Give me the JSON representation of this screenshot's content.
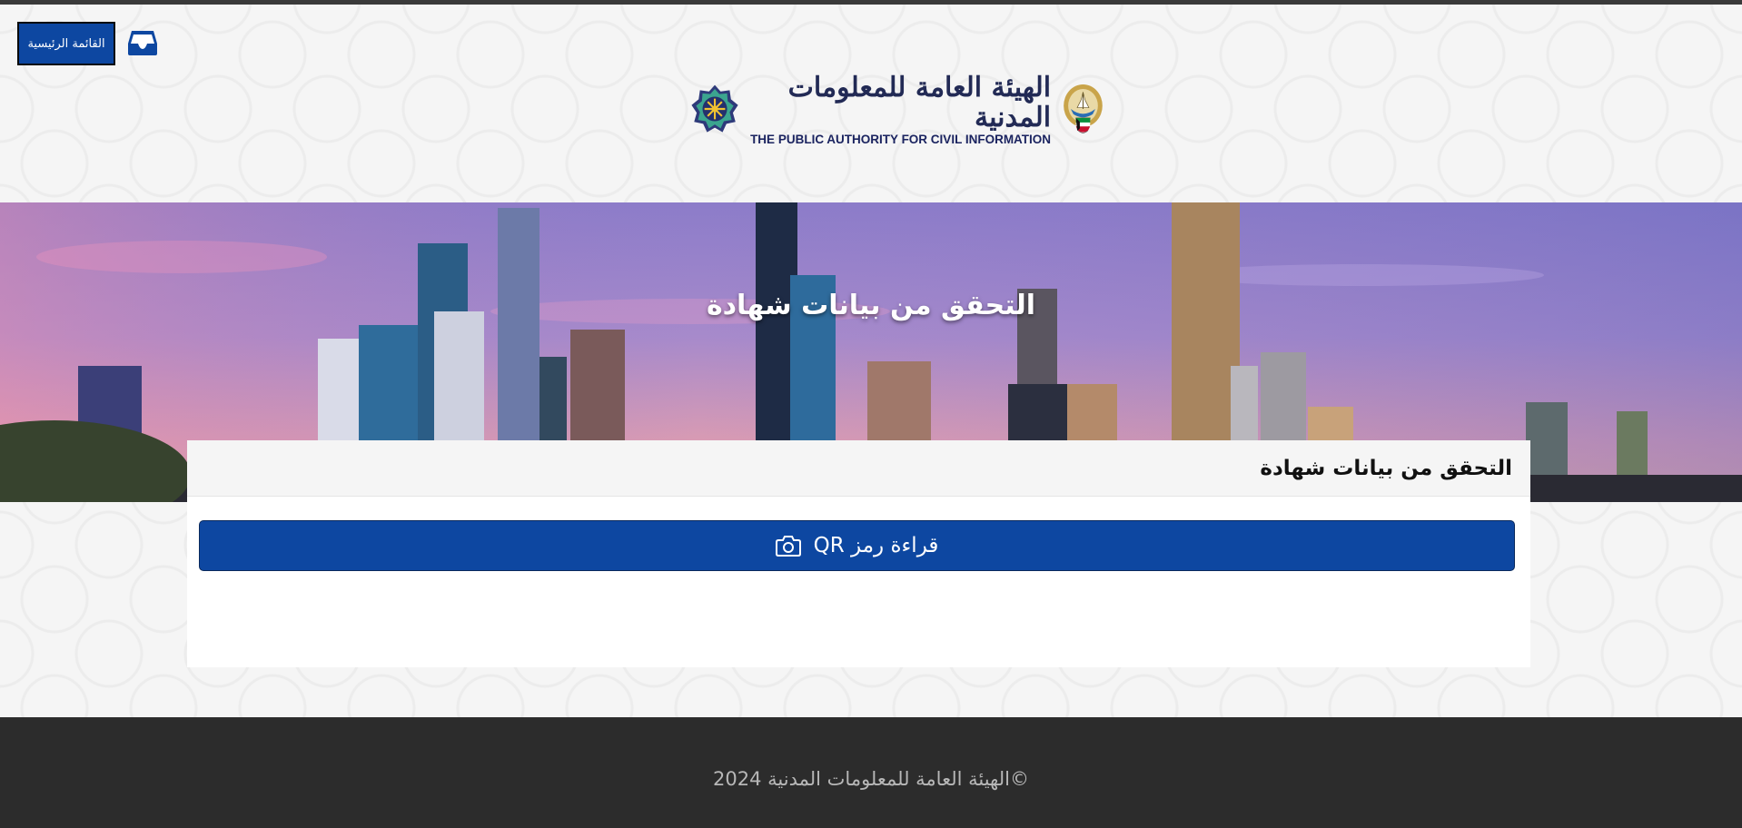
{
  "header": {
    "menu_label": "القائمة الرئيسية",
    "inbox_icon": "inbox-icon",
    "logo": {
      "arabic": "الهيئة العامة للمعلومات المدنية",
      "english": "THE PUBLIC AUTHORITY FOR CIVIL INFORMATION",
      "left_emblem": "paci-star-emblem",
      "right_emblem": "kuwait-emblem"
    }
  },
  "banner": {
    "title": "التحقق من بيانات شهادة"
  },
  "card": {
    "title": "التحقق من بيانات شهادة",
    "qr_button_label": "قراءة رمز QR",
    "qr_icon": "camera-icon"
  },
  "footer": {
    "copyright": "©الهيئة العامة للمعلومات المدنية 2024"
  },
  "colors": {
    "primary": "#0d47a1",
    "footer_bg": "#2c2c2c",
    "top_strip": "#3a3a3a"
  }
}
